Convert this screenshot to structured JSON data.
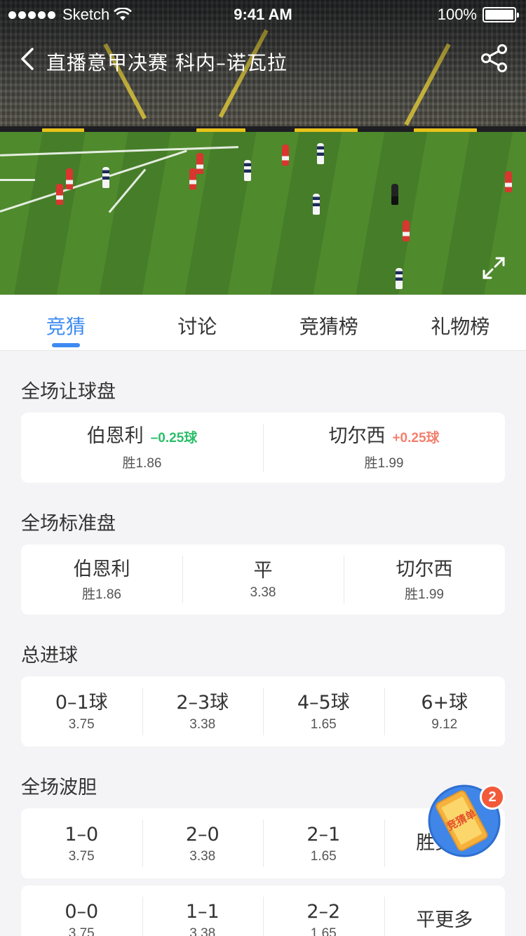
{
  "status_bar": {
    "carrier": "Sketch",
    "time": "9:41 AM",
    "battery": "100%"
  },
  "header": {
    "title": "直播意甲决赛 科内–诺瓦拉"
  },
  "tabs": [
    {
      "label": "竞猜",
      "active": true
    },
    {
      "label": "讨论",
      "active": false
    },
    {
      "label": "竞猜榜",
      "active": false
    },
    {
      "label": "礼物榜",
      "active": false
    }
  ],
  "handicap": {
    "title": "全场让球盘",
    "options": [
      {
        "team": "伯恩利",
        "line": "–0.25球",
        "odds": "胜1.86"
      },
      {
        "team": "切尔西",
        "line": "+0.25球",
        "odds": "胜1.99"
      }
    ]
  },
  "standard": {
    "title": "全场标准盘",
    "options": [
      {
        "label": "伯恩利",
        "odds": "胜1.86"
      },
      {
        "label": "平",
        "odds": "3.38"
      },
      {
        "label": "切尔西",
        "odds": "胜1.99"
      }
    ]
  },
  "total_goals": {
    "title": "总进球",
    "options": [
      {
        "label": "0–1球",
        "odds": "3.75"
      },
      {
        "label": "2–3球",
        "odds": "3.38"
      },
      {
        "label": "4–5球",
        "odds": "1.65"
      },
      {
        "label": "6+球",
        "odds": "9.12"
      }
    ]
  },
  "correct_score": {
    "title": "全场波胆",
    "row1": [
      {
        "label": "1–0",
        "odds": "3.75"
      },
      {
        "label": "2–0",
        "odds": "3.38"
      },
      {
        "label": "2–1",
        "odds": "1.65"
      },
      {
        "label": "胜更多",
        "odds": ""
      }
    ],
    "row2": [
      {
        "label": "0–0",
        "odds": "3.75"
      },
      {
        "label": "1–1",
        "odds": "3.38"
      },
      {
        "label": "2–2",
        "odds": "1.65"
      },
      {
        "label": "平更多",
        "odds": ""
      }
    ]
  },
  "bet_slip": {
    "label": "竞猜单",
    "count": "2"
  },
  "colors": {
    "accent": "#3d8bf2",
    "negative_handicap": "#2bbe69",
    "positive_handicap": "#f3806d",
    "badge": "#f25a3a"
  }
}
